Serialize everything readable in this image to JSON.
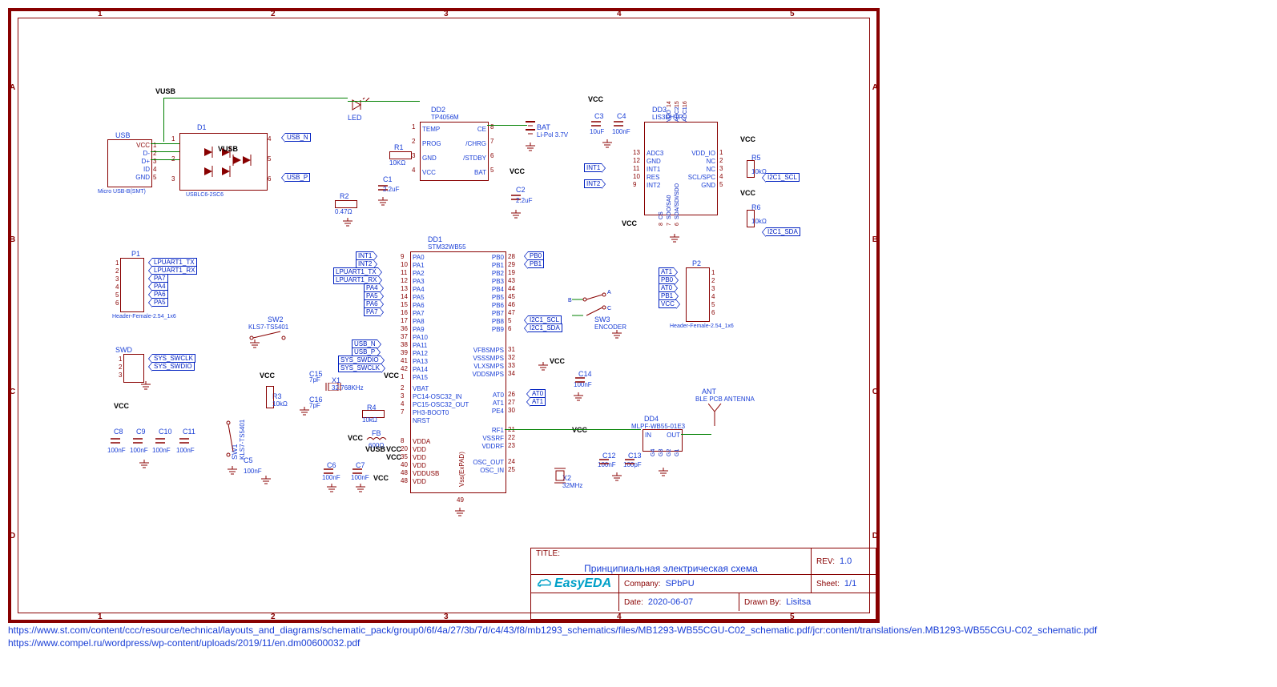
{
  "domain": "Diagram",
  "title_block": {
    "title_label": "TITLE:",
    "title": "Принципиальная электрическая схема",
    "rev_label": "REV:",
    "rev": "1.0",
    "company_label": "Company:",
    "company": "SPbPU",
    "sheet_label": "Sheet:",
    "sheet": "1/1",
    "date_label": "Date:",
    "date": "2020-06-07",
    "drawn_label": "Drawn By:",
    "drawn": "Lisitsa",
    "logo": "EasyEDA"
  },
  "footer": {
    "link1": "https://www.st.com/content/ccc/resource/technical/layouts_and_diagrams/schematic_pack/group0/6f/4a/27/3b/7d/c4/43/f8/mb1293_schematics/files/MB1293-WB55CGU-C02_schematic.pdf/jcr:content/translations/en.MB1293-WB55CGU-C02_schematic.pdf",
    "link2": "https://www.compel.ru/wordpress/wp-content/uploads/2019/11/en.dm00600032.pdf"
  },
  "grid": {
    "cols": [
      "1",
      "2",
      "3",
      "4",
      "5"
    ],
    "rows": [
      "A",
      "B",
      "C",
      "D"
    ]
  },
  "usb": {
    "ref": "USB",
    "part": "Micro USB-B(SMT)",
    "pins": [
      "VCC",
      "D-",
      "D+",
      "ID",
      "GND"
    ],
    "net_vusb": "VUSB"
  },
  "esd": {
    "ref": "D1",
    "part": "USBLC6-2SC6",
    "p1": "1",
    "p2": "2",
    "p3": "3",
    "p4": "4",
    "p5": "5",
    "p6": "6",
    "net_n": "USB_N",
    "net_p": "USB_P",
    "net_vusb": "VUSB"
  },
  "led": {
    "ref": "LED"
  },
  "r1": {
    "ref": "R1",
    "val": "10KΩ"
  },
  "r2": {
    "ref": "R2",
    "val": "0.47Ω"
  },
  "c1": {
    "ref": "C1",
    "val": "2.2uF"
  },
  "c2": {
    "ref": "C2",
    "val": "2.2uF"
  },
  "tp4056": {
    "ref": "DD2",
    "part": "TP4056M",
    "pins_l": [
      "TEMP",
      "PROG",
      "GND",
      "VCC"
    ],
    "pins_r": [
      "CE",
      "/CHRG",
      "/STDBY",
      "BAT"
    ],
    "nums_l": [
      "1",
      "2",
      "3",
      "4"
    ],
    "nums_r": [
      "8",
      "7",
      "6",
      "5"
    ]
  },
  "bat": {
    "ref": "BAT",
    "val": "Li-Pol 3.7V"
  },
  "vcc": "VCC",
  "c3": {
    "ref": "C3",
    "val": "10uF"
  },
  "c4": {
    "ref": "C4",
    "val": "100nF"
  },
  "lis": {
    "ref": "DD3",
    "part": "LIS3DHTR",
    "l": {
      "ADC3": "13",
      "GND": "12",
      "INT1": "11",
      "RES": "10",
      "INT2": "9"
    },
    "r": {
      "VDD_IO": "1",
      "NC": "2",
      "NC2": "3",
      "SCL/SPC": "4",
      "GND": "5"
    },
    "t": {
      "VDD": "14",
      "ADC2": "15",
      "ADC1": "16"
    },
    "b": {
      "CS": "8",
      "SDO/SA0": "7",
      "SDA/SDI/SDO": "6"
    },
    "int1": "INT1",
    "int2": "INT2"
  },
  "r5": {
    "ref": "R5",
    "val": "10kΩ"
  },
  "r6": {
    "ref": "R6",
    "val": "10kΩ"
  },
  "i2c_scl": "I2C1_SCL",
  "i2c_sda": "I2C1_SDA",
  "p1": {
    "ref": "P1",
    "part": "Header-Female-2.54_1x6",
    "nets": [
      "LPUART1_TX",
      "LPUART1_RX",
      "PA7",
      "PA4",
      "PA6",
      "PA5"
    ],
    "nums": [
      "1",
      "2",
      "3",
      "4",
      "5",
      "6"
    ]
  },
  "p2": {
    "ref": "P2",
    "part": "Header-Female-2.54_1x6",
    "nets": [
      "AT1",
      "PB0",
      "AT0",
      "PB1",
      "VCC",
      ""
    ],
    "nums": [
      "1",
      "2",
      "3",
      "4",
      "5",
      "6"
    ]
  },
  "swd": {
    "ref": "SWD",
    "nets": [
      "SYS_SWCLK",
      "SYS_SWDIO"
    ],
    "nums": [
      "1",
      "2",
      "3"
    ]
  },
  "stm": {
    "ref": "DD1",
    "part": "STM32WB55",
    "pa": {
      "PA0": "9",
      "PA1": "10",
      "PA2": "11",
      "PA3": "12",
      "PA4": "13",
      "PA5": "14",
      "PA6": "15",
      "PA7": "16",
      "PA8": "17",
      "PA9": "36",
      "PA10": "37",
      "PA11": "38",
      "PA12": "39",
      "PA13": "41",
      "PA14": "42",
      "PA15": "1"
    },
    "pa_nets": {
      "PA0": "INT1",
      "PA1": "INT2",
      "PA2": "LPUART1_TX",
      "PA3": "LPUART1_RX",
      "PA4": "PA4",
      "PA5": "PA5",
      "PA6": "PA6",
      "PA7": "PA7",
      "PA11": "USB_N",
      "PA12": "USB_P",
      "PA13": "SYS_SWDIO",
      "PA14": "SYS_SWCLK"
    },
    "pb": {
      "PB0": "28",
      "PB1": "29",
      "PB2": "19",
      "PB3": "43",
      "PB4": "44",
      "PB5": "45",
      "PB6": "46",
      "PB7": "47",
      "PB8": "5",
      "PB9": "6"
    },
    "pb_nets": {
      "PB0": "PB0",
      "PB1": "PB1",
      "PB8": "I2C1_SCL",
      "PB9": "I2C1_SDA"
    },
    "osc": {
      "VBAT": "2",
      "PC14-OSC32_IN": "3",
      "PC15-OSC32_OUT": "4",
      "PH3-BOOT0": "7",
      "NRST": ""
    },
    "rf": {
      "RF1": "21",
      "VSSRF": "22",
      "VDDRF": "23"
    },
    "smps": {
      "VFBSMPS": "31",
      "VSSSMPS": "32",
      "VLXSMPS": "33",
      "VDDSMPS": "34"
    },
    "at": {
      "AT0": "26",
      "AT1": "27",
      "PE4": "30"
    },
    "osc2": {
      "OSC_OUT": "24",
      "OSC_IN": "25"
    },
    "vdd": {
      "VDDA": "8",
      "VDD1": "20",
      "VDD2": "35",
      "VDD3": "40",
      "VDDUSB": "48",
      "VDD4": "48"
    },
    "vdd_labels": [
      "VDDA",
      "VDD",
      "VDD",
      "VDD",
      "VDDUSB",
      "VDD"
    ],
    "vss": "Vss(ExPAD)",
    "vss_num": "49"
  },
  "caps_row": {
    "c8": {
      "ref": "C8",
      "val": "100nF"
    },
    "c9": {
      "ref": "C9",
      "val": "100nF"
    },
    "c10": {
      "ref": "C10",
      "val": "100nF"
    },
    "c11": {
      "ref": "C11",
      "val": "100nF"
    }
  },
  "sw1": {
    "ref": "SW1",
    "part": "KLS7-TS5401"
  },
  "sw2": {
    "ref": "SW2",
    "part": "KLS7-TS5401"
  },
  "sw3": {
    "ref": "SW3",
    "part": "ENCODER",
    "pins": [
      "A",
      "B",
      "C"
    ]
  },
  "r3": {
    "ref": "R3",
    "val": "10kΩ"
  },
  "r4": {
    "ref": "R4",
    "val": "10kΩ"
  },
  "c5": {
    "ref": "C5",
    "val": "100nF"
  },
  "c6": {
    "ref": "C6",
    "val": "100nF"
  },
  "c7": {
    "ref": "C7",
    "val": "100nF"
  },
  "c12": {
    "ref": "C12",
    "val": "100nF"
  },
  "c13": {
    "ref": "C13",
    "val": "100pF"
  },
  "c14": {
    "ref": "C14",
    "val": "100nF"
  },
  "c15": {
    "ref": "C15",
    "val": "7pF"
  },
  "c16": {
    "ref": "C16",
    "val": "7pF"
  },
  "x1": {
    "ref": "X1",
    "val": "32.768KHz"
  },
  "x2": {
    "ref": "X2",
    "val": "32MHz"
  },
  "fb": {
    "ref": "FB",
    "val": "600Ω"
  },
  "dd4": {
    "ref": "DD4",
    "part": "MLPF-WB55-01E3",
    "in": "IN",
    "out": "OUT",
    "g": [
      "G4",
      "G3",
      "G2",
      "G1"
    ]
  },
  "ant": {
    "ref": "ANT",
    "part": "BLE PCB ANTENNA"
  },
  "at_nets": {
    "AT0": "AT0",
    "AT1": "AT1"
  }
}
